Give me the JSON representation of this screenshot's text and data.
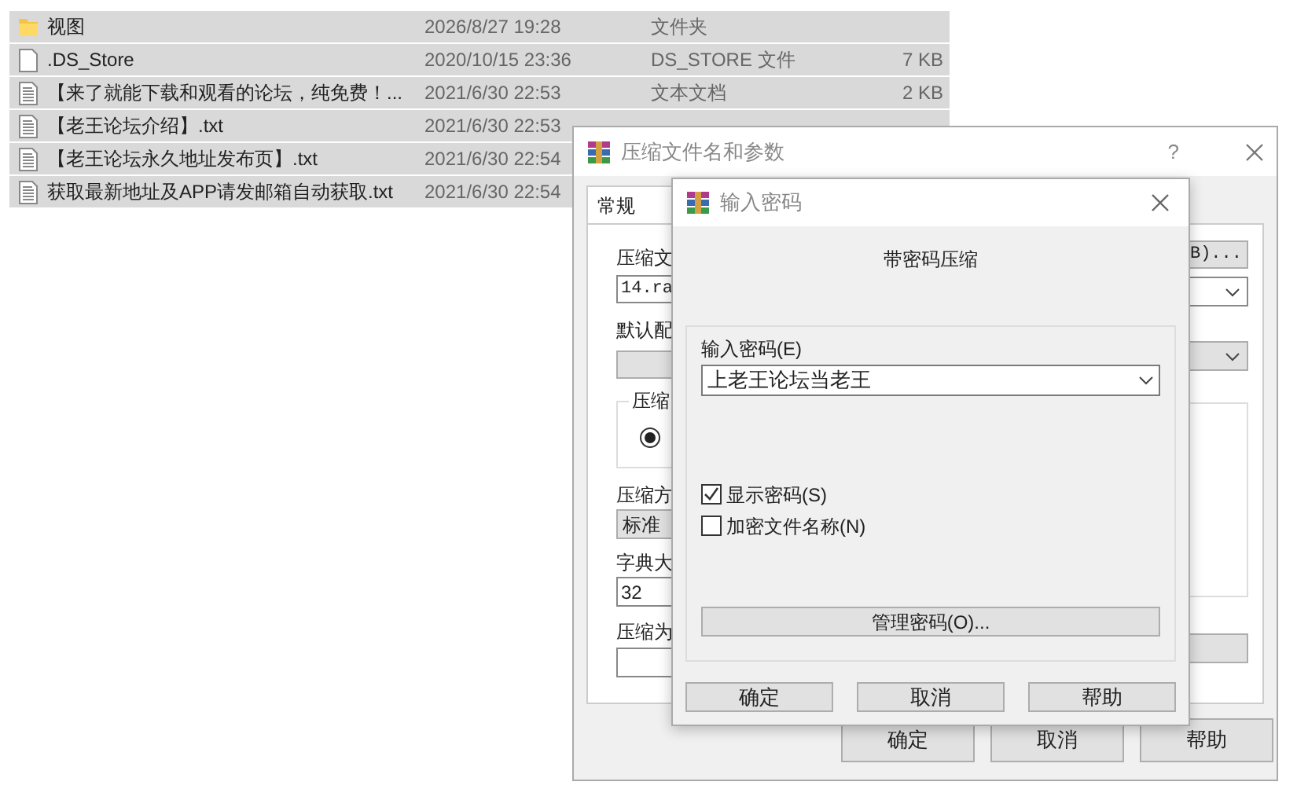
{
  "file_list": {
    "rows": [
      {
        "kind": "folder",
        "name": "视图",
        "modified": "2026/8/27 19:28",
        "type": "文件夹",
        "selected": true
      },
      {
        "kind": "file",
        "name": ".DS_Store",
        "modified": "2020/10/15 23:36",
        "type": "DS_STORE 文件",
        "size": "7 KB",
        "selected": true
      },
      {
        "kind": "text",
        "name": "【来了就能下载和观看的论坛，纯免费！...",
        "modified": "2021/6/30 22:53",
        "type": "文本文档",
        "size": "2 KB",
        "selected": true
      },
      {
        "kind": "text",
        "name": "【老王论坛介绍】.txt",
        "modified": "2021/6/30 22:53",
        "selected": true
      },
      {
        "kind": "text",
        "name": "【老王论坛永久地址发布页】.txt",
        "modified": "2021/6/30 22:54",
        "selected": true
      },
      {
        "kind": "text",
        "name": "获取最新地址及APP请发邮箱自动获取.txt",
        "modified": "2021/6/30 22:54",
        "selected": true
      }
    ]
  },
  "archive_dialog": {
    "title": "压缩文件名和参数",
    "help": "?",
    "tabs": [
      {
        "label": "常规",
        "selected": true
      }
    ],
    "left_labels": {
      "archive_name_label": "压缩文",
      "archive_name_value": "14.ra",
      "profile_label": "默认配",
      "group_label": "压缩",
      "method_label": "压缩方",
      "method_value": "标准",
      "dictionary_label": "字典大",
      "dictionary_value": "32",
      "split_label": "压缩为"
    },
    "format_radio": {
      "selected": true
    },
    "browse_button": "B)...",
    "buttons": [
      "确定",
      "取消",
      "帮助"
    ]
  },
  "password_dialog": {
    "title": "输入密码",
    "heading": "带密码压缩",
    "password_label": "输入密码(E)",
    "password_value": "上老王论坛当老王",
    "options": [
      {
        "label": "显示密码(S)",
        "checked": true
      },
      {
        "label": "加密文件名称(N)",
        "checked": false
      }
    ],
    "manage_button": "管理密码(O)...",
    "buttons": [
      "确定",
      "取消",
      "帮助"
    ]
  }
}
